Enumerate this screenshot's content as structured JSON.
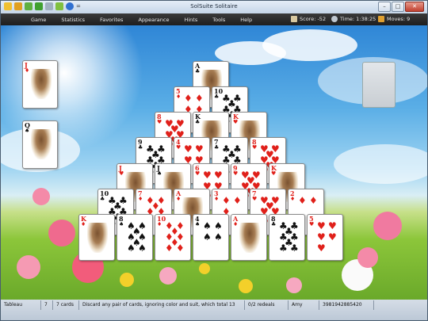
{
  "window": {
    "title": "SolSuite Solitaire"
  },
  "menu": [
    "Game",
    "Statistics",
    "Favorites",
    "Appearance",
    "Hints",
    "Tools",
    "Help"
  ],
  "status_top": {
    "score": "Score: -52",
    "time": "Time: 1:38:25",
    "moves": "Moves: 9"
  },
  "status_bar": {
    "area": "Tableau",
    "count": "7",
    "cards": "7 cards",
    "hint": "Discard any pair of cards, ignoring color and suit, which total 13",
    "redeals": "0/2 redeals",
    "player": "Amy",
    "game_number": "3981942885420"
  },
  "cards": {
    "left_top": {
      "rank": "J",
      "suit": "♦",
      "color": "red"
    },
    "left_bottom": {
      "rank": "Q",
      "suit": "♠",
      "color": "black"
    },
    "r1": [
      {
        "rank": "A",
        "suit": "♣",
        "color": "black"
      }
    ],
    "r2": [
      {
        "rank": "5",
        "suit": "♦",
        "color": "red"
      },
      {
        "rank": "10",
        "suit": "♣",
        "color": "black"
      }
    ],
    "r3": [
      {
        "rank": "8",
        "suit": "♥",
        "color": "red"
      },
      {
        "rank": "K",
        "suit": "♣",
        "color": "black"
      },
      {
        "rank": "K",
        "suit": "♥",
        "color": "red"
      }
    ],
    "r4": [
      {
        "rank": "9",
        "suit": "♣",
        "color": "black"
      },
      {
        "rank": "4",
        "suit": "♥",
        "color": "red"
      },
      {
        "rank": "7",
        "suit": "♣",
        "color": "black"
      },
      {
        "rank": "8",
        "suit": "♥",
        "color": "red"
      }
    ],
    "r5": [
      {
        "rank": "J",
        "suit": "♥",
        "color": "red"
      },
      {
        "rank": "J",
        "suit": "♠",
        "color": "black"
      },
      {
        "rank": "6",
        "suit": "♥",
        "color": "red"
      },
      {
        "rank": "9",
        "suit": "♥",
        "color": "red"
      },
      {
        "rank": "K",
        "suit": "♥",
        "color": "red"
      }
    ],
    "r6": [
      {
        "rank": "10",
        "suit": "♣",
        "color": "black"
      },
      {
        "rank": "7",
        "suit": "♦",
        "color": "red"
      },
      {
        "rank": "A",
        "suit": "♦",
        "color": "red"
      },
      {
        "rank": "3",
        "suit": "♦",
        "color": "red"
      },
      {
        "rank": "7",
        "suit": "♥",
        "color": "red"
      },
      {
        "rank": "2",
        "suit": "♦",
        "color": "red"
      }
    ],
    "r7": [
      {
        "rank": "K",
        "suit": "♦",
        "color": "red"
      },
      {
        "rank": "8",
        "suit": "♠",
        "color": "black"
      },
      {
        "rank": "10",
        "suit": "♦",
        "color": "red"
      },
      {
        "rank": "4",
        "suit": "♠",
        "color": "black"
      },
      {
        "rank": "A",
        "suit": "♦",
        "color": "red"
      },
      {
        "rank": "8",
        "suit": "♣",
        "color": "black"
      },
      {
        "rank": "5",
        "suit": "♥",
        "color": "red"
      }
    ]
  }
}
